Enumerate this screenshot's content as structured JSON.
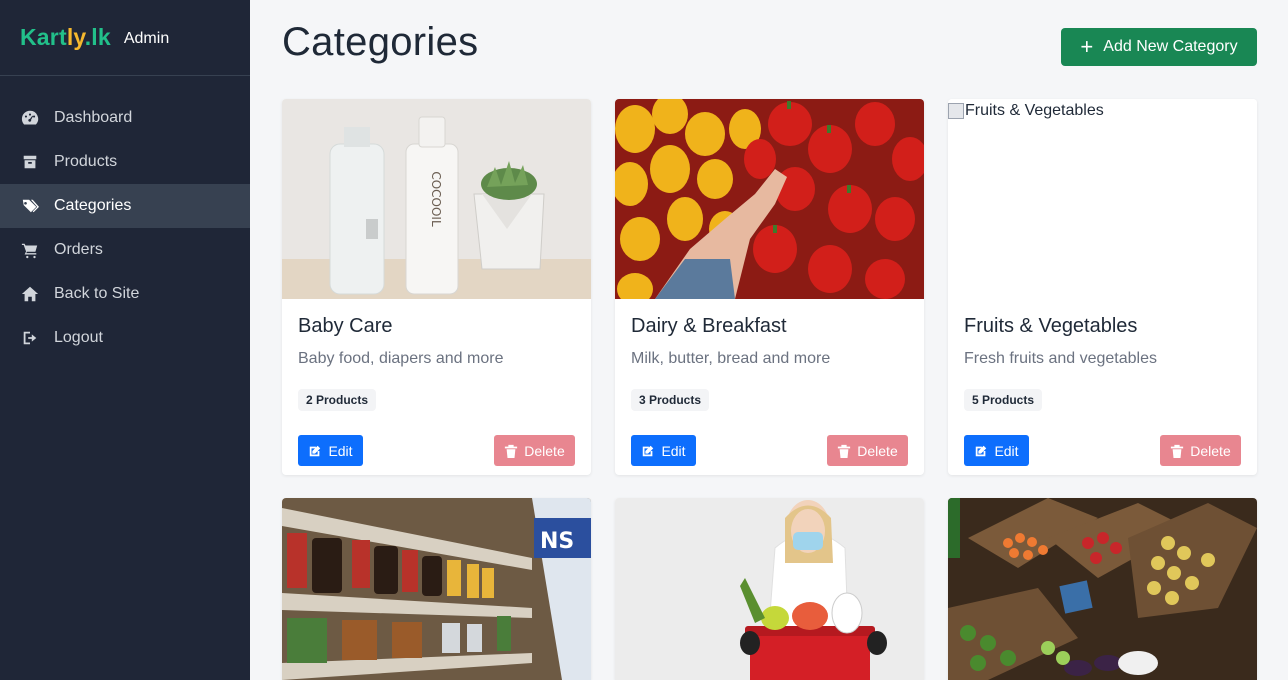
{
  "brand": {
    "name_a": "Kart",
    "name_b": "ly",
    "name_c": ".lk",
    "subtitle": "Admin",
    "colors": {
      "green": "#22c08a",
      "yellow": "#f5b82e"
    }
  },
  "nav": [
    {
      "label": "Dashboard",
      "icon": "dashboard-icon"
    },
    {
      "label": "Products",
      "icon": "box-icon"
    },
    {
      "label": "Categories",
      "icon": "tags-icon",
      "active": true
    },
    {
      "label": "Orders",
      "icon": "cart-icon"
    },
    {
      "label": "Back to Site",
      "icon": "home-icon"
    },
    {
      "label": "Logout",
      "icon": "logout-icon"
    }
  ],
  "page": {
    "title": "Categories",
    "add_button": "Add New Category"
  },
  "categories": [
    {
      "name": "Baby Care",
      "description": "Baby food, diapers and more",
      "count": "2 Products"
    },
    {
      "name": "Dairy & Breakfast",
      "description": "Milk, butter, bread and more",
      "count": "3 Products"
    },
    {
      "name": "Fruits & Vegetables",
      "description": "Fresh fruits and vegetables",
      "count": "5 Products",
      "image_alt": "Fruits & Vegetables"
    }
  ],
  "actions": {
    "edit": "Edit",
    "delete": "Delete"
  },
  "colors": {
    "sidebar": "#1f2637",
    "add": "#198754",
    "edit": "#0d6efd",
    "delete": "#e88690"
  }
}
